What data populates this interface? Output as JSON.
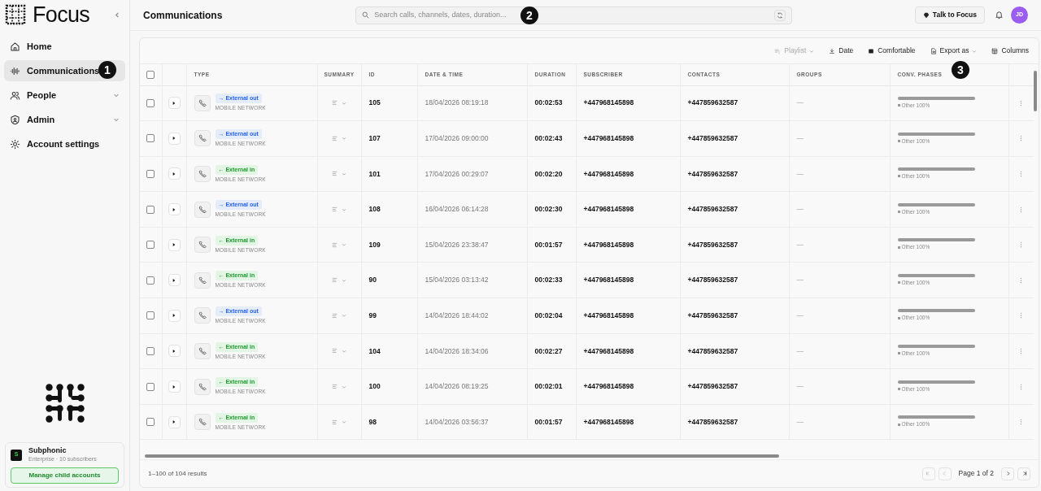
{
  "sidebar": {
    "brand": "Focus",
    "items": [
      {
        "label": "Home",
        "selected": false
      },
      {
        "label": "Communications",
        "selected": true
      },
      {
        "label": "People",
        "selected": false,
        "expandable": true
      },
      {
        "label": "Admin",
        "selected": false,
        "expandable": true
      },
      {
        "label": "Account settings",
        "selected": false
      }
    ],
    "account": {
      "badge": "S",
      "name": "Subphonic",
      "plan": "Enterprise · 10 subscribers",
      "button": "Manage child accounts"
    }
  },
  "header": {
    "title": "Communications",
    "search": {
      "placeholder": "Search calls, channels, dates, duration..."
    },
    "assistant_button": "Talk to Focus",
    "avatar": "JD"
  },
  "toolbar": [
    {
      "label": "Playlist",
      "disabled": true,
      "dropdown": true
    },
    {
      "label": "Date",
      "disabled": false,
      "dropdown": false
    },
    {
      "label": "Comfortable",
      "disabled": false,
      "dropdown": false
    },
    {
      "label": "Export as",
      "disabled": false,
      "dropdown": true
    },
    {
      "label": "Columns",
      "disabled": false,
      "dropdown": false
    }
  ],
  "table": {
    "all_checked": false,
    "columns": [
      "TYPE",
      "SUMMARY",
      "ID",
      "DATE & TIME",
      "DURATION",
      "SUBSCRIBER",
      "CONTACTS",
      "GROUPS",
      "CONV. PHASES"
    ],
    "rows": [
      {
        "checked": false,
        "kind": "out",
        "type": "→ External out",
        "network": "MOBILE NETWORK",
        "id": "105",
        "datetime": "18/04/2026 08:19:18",
        "duration": "00:02:53",
        "subscriber": "+447968145898",
        "contacts": "+447859632587",
        "groups": "—",
        "phase": {
          "level": 1,
          "label": "Other 100%"
        }
      },
      {
        "checked": false,
        "kind": "out",
        "type": "→ External out",
        "network": "MOBILE NETWORK",
        "id": "107",
        "datetime": "17/04/2026 09:00:00",
        "duration": "00:02:43",
        "subscriber": "+447968145898",
        "contacts": "+447859632587",
        "groups": "—",
        "phase": {
          "level": 1,
          "label": "Other 100%"
        }
      },
      {
        "checked": false,
        "kind": "in",
        "type": "← External in",
        "network": "MOBILE NETWORK",
        "id": "101",
        "datetime": "17/04/2026 00:29:07",
        "duration": "00:02:20",
        "subscriber": "+447968145898",
        "contacts": "+447859632587",
        "groups": "—",
        "phase": {
          "level": 1,
          "label": "Other 100%"
        }
      },
      {
        "checked": false,
        "kind": "out",
        "type": "→ External out",
        "network": "MOBILE NETWORK",
        "id": "108",
        "datetime": "16/04/2026 06:14:28",
        "duration": "00:02:30",
        "subscriber": "+447968145898",
        "contacts": "+447859632587",
        "groups": "—",
        "phase": {
          "level": 1,
          "label": "Other 100%"
        }
      },
      {
        "checked": false,
        "kind": "in",
        "type": "← External in",
        "network": "MOBILE NETWORK",
        "id": "109",
        "datetime": "15/04/2026 23:38:47",
        "duration": "00:01:57",
        "subscriber": "+447968145898",
        "contacts": "+447859632587",
        "groups": "—",
        "phase": {
          "level": 1,
          "label": "Other 100%"
        }
      },
      {
        "checked": false,
        "kind": "in",
        "type": "← External in",
        "network": "MOBILE NETWORK",
        "id": "90",
        "datetime": "15/04/2026 03:13:42",
        "duration": "00:02:33",
        "subscriber": "+447968145898",
        "contacts": "+447859632587",
        "groups": "—",
        "phase": {
          "level": 1,
          "label": "Other 100%"
        }
      },
      {
        "checked": false,
        "kind": "out",
        "type": "→ External out",
        "network": "MOBILE NETWORK",
        "id": "99",
        "datetime": "14/04/2026 18:44:02",
        "duration": "00:02:04",
        "subscriber": "+447968145898",
        "contacts": "+447859632587",
        "groups": "—",
        "phase": {
          "level": 1,
          "label": "Other 100%"
        }
      },
      {
        "checked": false,
        "kind": "in",
        "type": "← External in",
        "network": "MOBILE NETWORK",
        "id": "104",
        "datetime": "14/04/2026 18:34:06",
        "duration": "00:02:27",
        "subscriber": "+447968145898",
        "contacts": "+447859632587",
        "groups": "—",
        "phase": {
          "level": 1,
          "label": "Other 100%"
        }
      },
      {
        "checked": false,
        "kind": "in",
        "type": "← External in",
        "network": "MOBILE NETWORK",
        "id": "100",
        "datetime": "14/04/2026 08:19:25",
        "duration": "00:02:01",
        "subscriber": "+447968145898",
        "contacts": "+447859632587",
        "groups": "—",
        "phase": {
          "level": 1,
          "label": "Other 100%"
        }
      },
      {
        "checked": false,
        "kind": "in",
        "type": "← External in",
        "network": "MOBILE NETWORK",
        "id": "98",
        "datetime": "14/04/2026 03:56:37",
        "duration": "00:01:57",
        "subscriber": "+447968145898",
        "contacts": "+447859632587",
        "groups": "—",
        "phase": {
          "level": 1,
          "label": "Other 100%"
        }
      }
    ]
  },
  "footer": {
    "results": "1–100 of 104 results",
    "page": "Page 1 of 2"
  },
  "callouts": [
    "1",
    "2",
    "3"
  ]
}
